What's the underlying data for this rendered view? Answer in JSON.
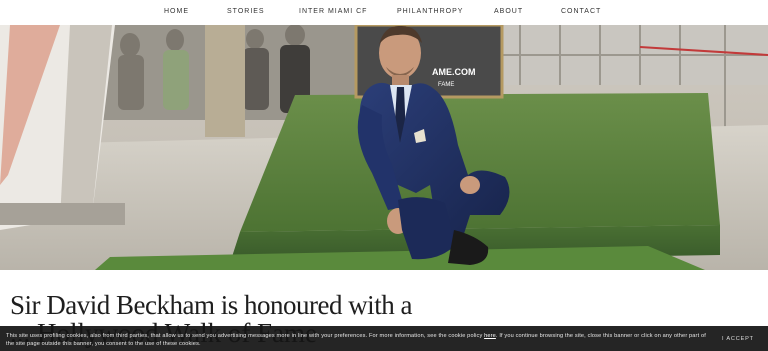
{
  "nav": {
    "items": [
      {
        "label": "HOME"
      },
      {
        "label": "STORIES"
      },
      {
        "label": "INTER MIAMI CF"
      },
      {
        "label": "PHILANTHROPY"
      },
      {
        "label": "ABOUT"
      },
      {
        "label": "CONTACT"
      }
    ]
  },
  "hero": {
    "sign_text_1": "AME.COM",
    "sign_text_2": "FAME"
  },
  "article": {
    "headline_line1": "Sir David Beckham is honoured with a",
    "headline_line2": "... Hollywood Walk of Fame"
  },
  "cookie_banner": {
    "text_before_link": "This site uses profiling cookies, also from third parties, that allow us to send you advertising messages more in line with your preferences. For more information, see the cookie policy",
    "link_label": "here",
    "text_after_link": ". If you continue browsing the site, close this banner or click on any other part of the site page outside this banner, you consent to the use of these cookies.",
    "accept_label": "I ACCEPT"
  },
  "colors": {
    "nav_text": "#333333",
    "banner_bg": "#141414",
    "carpet_green": "#4f7a36",
    "suit_navy": "#1f2f5e"
  }
}
